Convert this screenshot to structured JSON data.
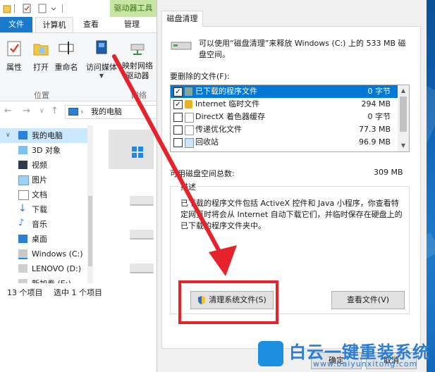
{
  "explorer": {
    "context_tab": "驱动器工具",
    "tabs": {
      "file": "文件",
      "computer": "计算机",
      "view": "查看",
      "manage": "管理"
    },
    "ribbon": {
      "properties": "属性",
      "open": "打开",
      "rename": "重命名",
      "access_media": "访问媒体",
      "map_drive": "映射网络驱动器",
      "group_location": "位置",
      "group_network": "网络"
    },
    "address": "我的电脑",
    "tree": [
      "我的电脑",
      "3D 对象",
      "视频",
      "图片",
      "文档",
      "下载",
      "音乐",
      "桌面",
      "Windows (C:)",
      "LENOVO (D:)",
      "新加卷 (E:)"
    ],
    "status": {
      "count": "13 个项目",
      "selected": "选中 1 个项目"
    }
  },
  "dialog": {
    "tab": "磁盘清理",
    "intro": "可以使用“磁盘清理”来释放 Windows (C:) 上的 533 MB 磁盘空间。",
    "files_label": "要删除的文件(F):",
    "files": [
      {
        "name": "已下载的程序文件",
        "size": "0 字节",
        "checked": true,
        "selected": true
      },
      {
        "name": "Internet 临时文件",
        "size": "294 MB",
        "checked": true,
        "selected": false
      },
      {
        "name": "DirectX 着色器缓存",
        "size": "0 字节",
        "checked": false,
        "selected": false
      },
      {
        "name": "传递优化文件",
        "size": "77.3 MB",
        "checked": false,
        "selected": false
      },
      {
        "name": "回收站",
        "size": "96.9 MB",
        "checked": false,
        "selected": false
      }
    ],
    "total_label": "可用磁盘空间总数:",
    "total_value": "309 MB",
    "desc_legend": "描述",
    "desc_text": "已下载的程序文件包括 ActiveX 控件和 Java 小程序，你查看特定网页时将会从 Internet 自动下载它们，并临时保存在硬盘上的已下载的程序文件夹中。",
    "clean_system_button": "清理系统文件(S)",
    "view_files_button": "查看文件(V)",
    "ok_button": "确定",
    "cancel_button": "取消"
  },
  "watermark": {
    "name": "白云一键重装系统",
    "url": "www.baiyunxitong.com"
  },
  "colors": {
    "annotation": "#e6222a",
    "selection": "#0078d7",
    "ribbon_context": "#c7e5a3"
  }
}
